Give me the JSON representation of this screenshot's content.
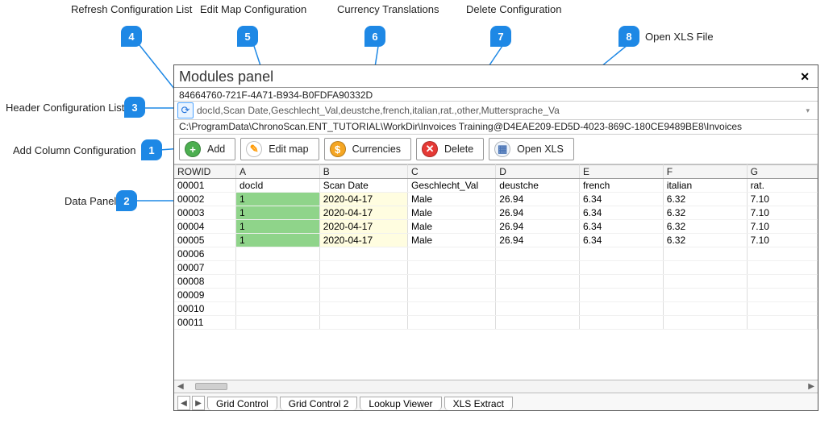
{
  "callouts": {
    "c1": {
      "num": "1",
      "label": "Add Column Configuration"
    },
    "c2": {
      "num": "2",
      "label": "Data Panel"
    },
    "c3": {
      "num": "3",
      "label": "Header Configuration List"
    },
    "c4": {
      "num": "4",
      "label": "Refresh Configuration List"
    },
    "c5": {
      "num": "5",
      "label": "Edit Map Configuration"
    },
    "c6": {
      "num": "6",
      "label": "Currency Translations"
    },
    "c7": {
      "num": "7",
      "label": "Delete Configuration"
    },
    "c8": {
      "num": "8",
      "label": "Open XLS File"
    }
  },
  "panel": {
    "title": "Modules panel",
    "close": "✕",
    "guid": "84664760-721F-4A71-B934-B0FDFA90332D",
    "columns_list": "docId,Scan Date,Geschlecht_Val,deustche,french,italian,rat.,other,Muttersprache_Va",
    "path": "C:\\ProgramData\\ChronoScan.ENT_TUTORIAL\\WorkDir\\Invoices Training@D4EAE209-ED5D-4023-869C-180CE9489BE8\\Invoices",
    "refresh_glyph": "⟳"
  },
  "toolbar": {
    "add": {
      "glyph": "+",
      "label": "Add"
    },
    "editmap": {
      "glyph": "✎",
      "label": "Edit map"
    },
    "curr": {
      "glyph": "$",
      "label": "Currencies"
    },
    "del": {
      "glyph": "✕",
      "label": "Delete"
    },
    "xls": {
      "glyph": "▦",
      "label": "Open XLS"
    }
  },
  "grid": {
    "headers": {
      "rowid": "ROWID",
      "A": "A",
      "B": "B",
      "C": "C",
      "D": "D",
      "E": "E",
      "F": "F",
      "G": "G"
    },
    "subheaders": {
      "A": "docId",
      "B": "Scan Date",
      "C": "Geschlecht_Val",
      "D": "deustche",
      "E": "french",
      "F": "italian",
      "G": "rat."
    },
    "rows": [
      {
        "rowid": "00001"
      },
      {
        "rowid": "00002",
        "A": "1",
        "B": "2020-04-17",
        "C": "Male",
        "D": "26.94",
        "E": "6.34",
        "F": "6.32",
        "G": "7.10"
      },
      {
        "rowid": "00003",
        "A": "1",
        "B": "2020-04-17",
        "C": "Male",
        "D": "26.94",
        "E": "6.34",
        "F": "6.32",
        "G": "7.10"
      },
      {
        "rowid": "00004",
        "A": "1",
        "B": "2020-04-17",
        "C": "Male",
        "D": "26.94",
        "E": "6.34",
        "F": "6.32",
        "G": "7.10"
      },
      {
        "rowid": "00005",
        "A": "1",
        "B": "2020-04-17",
        "C": "Male",
        "D": "26.94",
        "E": "6.34",
        "F": "6.32",
        "G": "7.10"
      },
      {
        "rowid": "00006"
      },
      {
        "rowid": "00007"
      },
      {
        "rowid": "00008"
      },
      {
        "rowid": "00009"
      },
      {
        "rowid": "00010"
      },
      {
        "rowid": "00011"
      }
    ]
  },
  "tabs": {
    "left_nav": "◀",
    "right_nav": "▶",
    "items": [
      "Grid Control",
      "Grid Control 2",
      "Lookup Viewer",
      "XLS Extract"
    ]
  },
  "scroll": {
    "left": "◀",
    "right": "▶"
  }
}
